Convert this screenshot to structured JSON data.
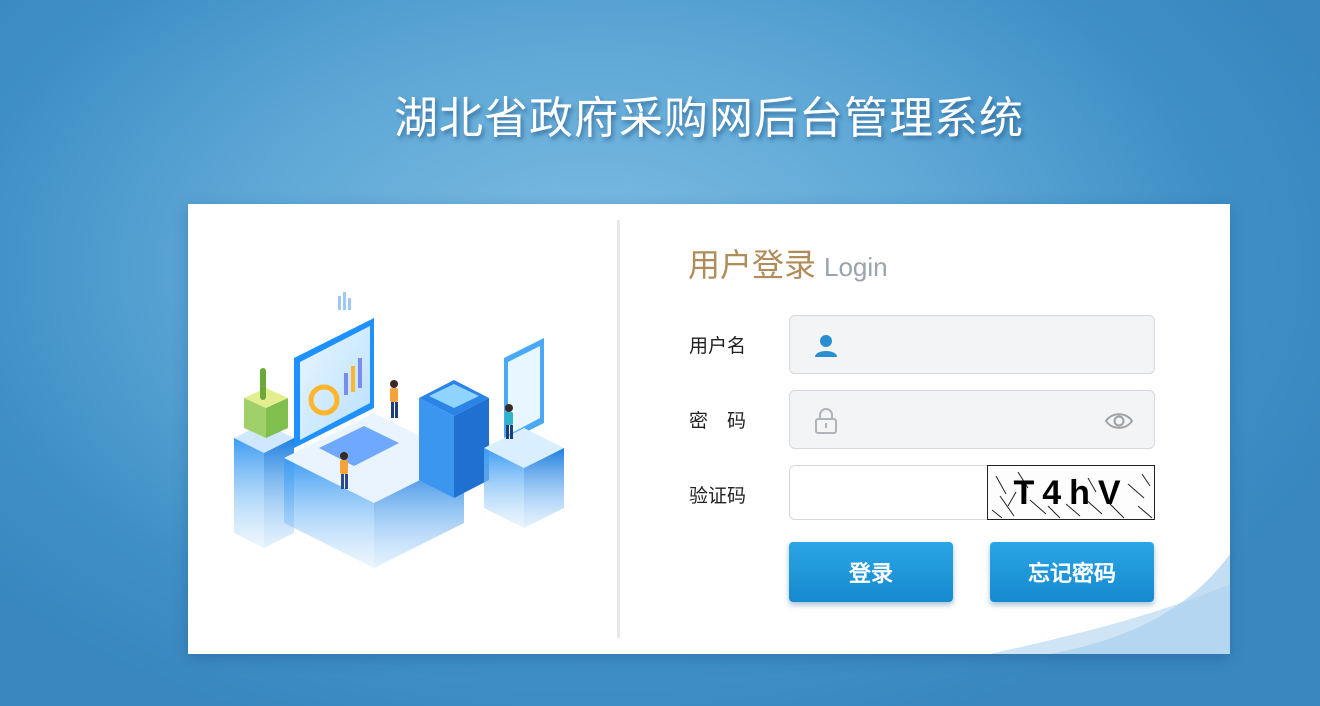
{
  "page": {
    "title": "湖北省政府采购网后台管理系统"
  },
  "login": {
    "heading_cn": "用户登录",
    "heading_en": "Login",
    "username_label": "用户名",
    "password_label": "密　码",
    "captcha_label": "验证码",
    "username_value": "",
    "password_value": "",
    "captcha_value": "",
    "captcha_text": "T4hV",
    "login_button": "登录",
    "forgot_button": "忘记密码"
  },
  "icons": {
    "username": "user-icon",
    "password": "lock-icon",
    "reveal": "eye-icon"
  },
  "colors": {
    "heading_cn": "#b08c5a",
    "heading_en": "#9aa3ab",
    "button": "#1e95d9",
    "user_icon": "#2a8fd0"
  }
}
